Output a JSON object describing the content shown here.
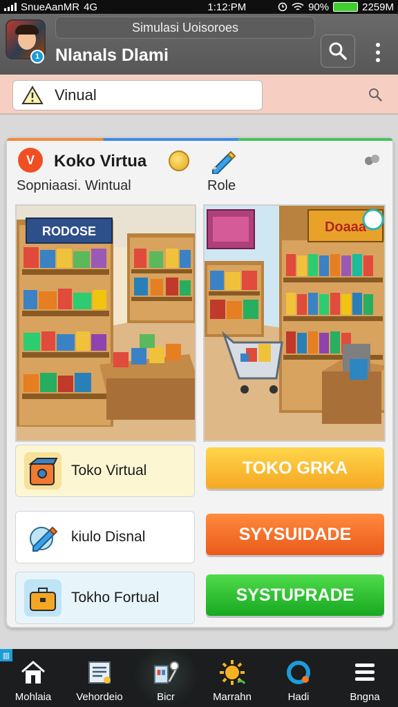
{
  "status_bar": {
    "carrier": "SnueAanMR",
    "network": "4G",
    "time": "1:12:PM",
    "battery_percent": "90%",
    "right_text": "2259M"
  },
  "header": {
    "window_title": "Simulasi Uoisoroes",
    "app_title": "Nlanals Dlami",
    "avatar_badge": "1"
  },
  "search": {
    "value": "Vinual",
    "placeholder": ""
  },
  "card": {
    "title": "Koko Virtua",
    "subtitle": "Sopniaasi. Wintual",
    "role_label": "Role",
    "scene_left_sign": "RODOSE",
    "scene_right_sign": "Doaaa"
  },
  "options": [
    {
      "label": "Toko Virtual",
      "icon": "shop-box-icon",
      "bg": "#fdf6d2"
    },
    {
      "label": "kiulo Disnal",
      "icon": "pencil-icon",
      "bg": "#ffffff"
    },
    {
      "label": "Tokho Fortual",
      "icon": "briefcase-icon",
      "bg": "#e7f5fb"
    }
  ],
  "buttons": [
    {
      "label": "TOKO GRKA",
      "color": "yellow"
    },
    {
      "label": "SYYSUIDADE",
      "color": "orange"
    },
    {
      "label": "SYSTUPRADE",
      "color": "green"
    }
  ],
  "bottom_nav": [
    {
      "label": "Mohlaia",
      "icon": "home-icon",
      "active": false
    },
    {
      "label": "Vehordeio",
      "icon": "document-icon",
      "active": false
    },
    {
      "label": "Bicr",
      "icon": "shop-scene-icon",
      "active": true
    },
    {
      "label": "Marrahn",
      "icon": "sun-icon",
      "active": false
    },
    {
      "label": "Hadi",
      "icon": "ring-icon",
      "active": false
    },
    {
      "label": "Bngna",
      "icon": "menu-icon",
      "active": false
    }
  ],
  "colors": {
    "header_bg": "#5f5f5f",
    "search_strip": "#f7cfc2",
    "btn_yellow": "#f7b52a",
    "btn_orange": "#f06a25",
    "btn_green": "#22b52a",
    "nav_bg": "#1b1d1e"
  }
}
